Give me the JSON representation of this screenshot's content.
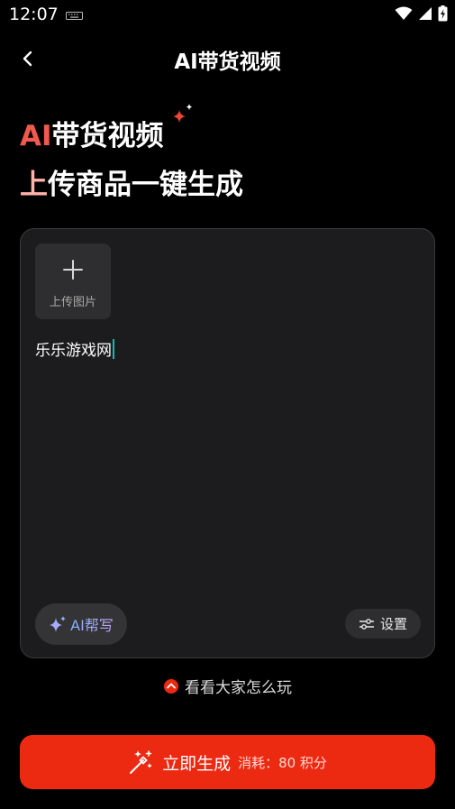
{
  "status_bar": {
    "time": "12:07"
  },
  "nav": {
    "title": "AI带货视频"
  },
  "hero": {
    "line1_ai": "AI",
    "line1_rest": "带货视频",
    "line2_first": "上",
    "line2_rest": "传商品一键生成"
  },
  "card": {
    "upload_label": "上传图片",
    "prompt_value": "乐乐游戏网",
    "ai_help_label": "AI帮写",
    "settings_label": "设置"
  },
  "see_others": {
    "label": "看看大家怎么玩"
  },
  "generate": {
    "label": "立即生成",
    "cost": "消耗：80 积分"
  },
  "colors": {
    "accent": "#ec2a12",
    "card_bg": "#1c1c1e",
    "caret": "#1fb5a6"
  }
}
